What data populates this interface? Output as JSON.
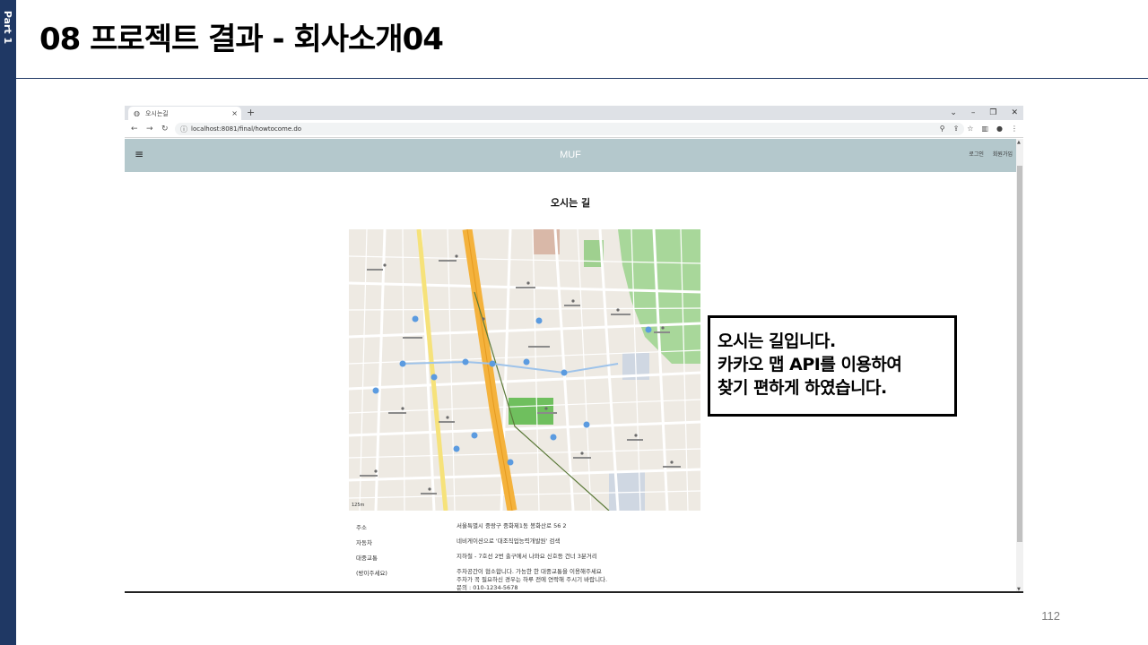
{
  "slide": {
    "side_label": "Part 1",
    "title": "08 프로젝트 결과 - 회사소개04",
    "page_number": "112"
  },
  "browser": {
    "tab_title": "오시는길",
    "tab_close": "×",
    "new_tab": "+",
    "url": "localhost:8081/final/howtocome.do",
    "window_controls": [
      "⌄",
      "–",
      "❐",
      "✕"
    ],
    "nav": {
      "back": "←",
      "forward": "→",
      "reload": "↻",
      "info": "ⓘ"
    },
    "addr_tools": [
      "⚲",
      "⇪",
      "☆",
      "▥",
      "●",
      "⋮"
    ]
  },
  "site": {
    "menu_icon": "≡",
    "brand": "MUF",
    "header_links": [
      "로그인",
      "회원가입"
    ],
    "page_heading": "오시는 길"
  },
  "map": {
    "scale_label": "125m"
  },
  "info_table": [
    {
      "key": "주소",
      "value": "서울특별시 중랑구 중화제1동 봉화산로 56 2"
    },
    {
      "key": "자동차",
      "value": "네비게이션으로 '대조직업능력개발원' 검색"
    },
    {
      "key": "대중교통",
      "value": "지하철 - 7호선 2번 출구에서 나와요 신호등 건너 3분거리"
    },
    {
      "key": "(방이주세요)",
      "value": "주차공간이 협소합니다. 가능한 한 대중교통을 이용해주세요\n주차가 꼭 필요하신 경우는 하루 전에 연락해 주시기 바랍니다.\n문의 : 010-1234-5678"
    }
  ],
  "callout": {
    "lines": [
      "오시는 길입니다.",
      "카카오 맵 API를 이용하여",
      "찾기 편하게 하였습니다."
    ]
  },
  "colors": {
    "side_bar": "#1f3864",
    "site_header": "#b4c8cc",
    "map_road_major": "#f4b23c",
    "map_park": "#a8d79a"
  }
}
